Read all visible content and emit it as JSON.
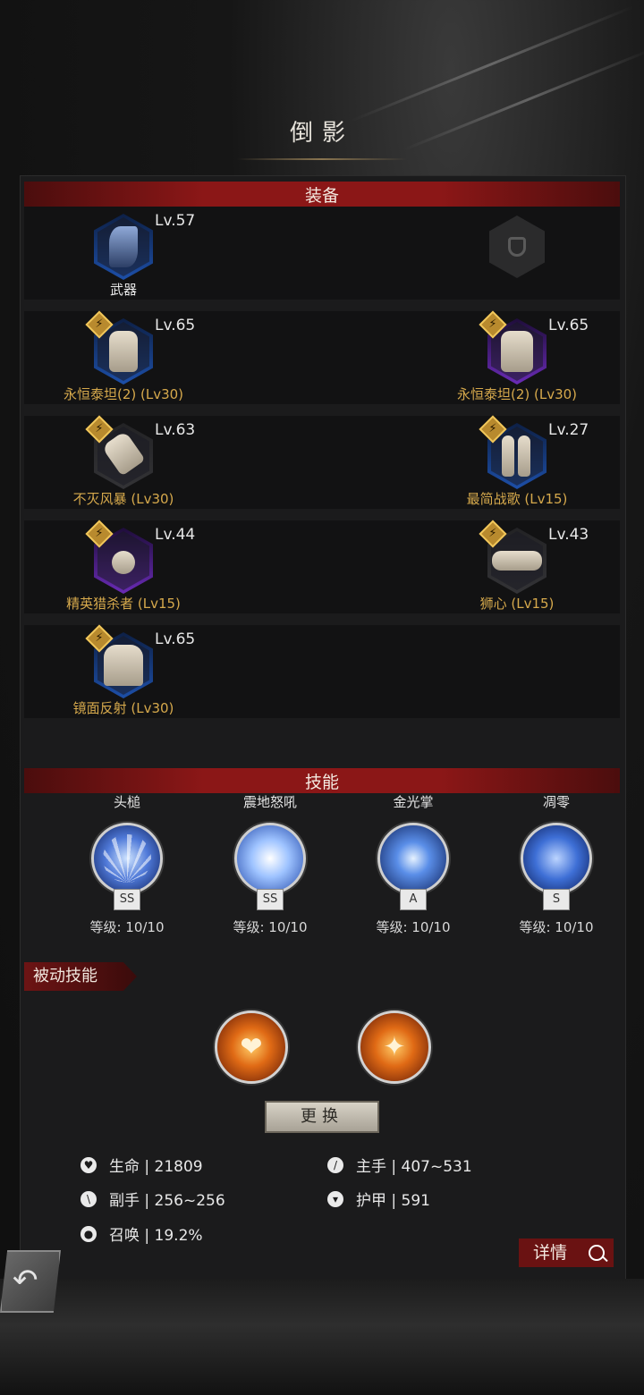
{
  "title": "倒影",
  "equipment": {
    "header": "装备",
    "rows": [
      {
        "left": {
          "level": "Lv.57",
          "name": "武器",
          "tier": "blue",
          "set": false,
          "icon": "axe-icon"
        },
        "right": {
          "level": "",
          "name": "",
          "tier": "empty",
          "set": false,
          "icon": "shield-slot-icon"
        }
      },
      {
        "left": {
          "level": "Lv.65",
          "name": "永恒泰坦(2) (Lv30)",
          "tier": "blue",
          "set": true,
          "icon": "helmet-icon"
        },
        "right": {
          "level": "Lv.65",
          "name": "永恒泰坦(2) (Lv30)",
          "tier": "purple",
          "set": true,
          "icon": "chest-armor-icon"
        }
      },
      {
        "left": {
          "level": "Lv.63",
          "name": "不灭风暴 (Lv30)",
          "tier": "dark",
          "set": true,
          "icon": "gauntlet-icon"
        },
        "right": {
          "level": "Lv.27",
          "name": "最简战歌 (Lv15)",
          "tier": "blue",
          "set": true,
          "icon": "boots-icon"
        }
      },
      {
        "left": {
          "level": "Lv.44",
          "name": "精英猎杀者 (Lv15)",
          "tier": "purple",
          "set": true,
          "icon": "trinket-icon"
        },
        "right": {
          "level": "Lv.43",
          "name": "狮心 (Lv15)",
          "tier": "dark",
          "set": true,
          "icon": "belt-icon"
        }
      },
      {
        "left": {
          "level": "Lv.65",
          "name": "镜面反射 (Lv30)",
          "tier": "blue",
          "set": true,
          "icon": "cloak-icon"
        },
        "right": null
      }
    ]
  },
  "skills": {
    "header": "技能",
    "items": [
      {
        "name": "头槌",
        "grade": "SS",
        "level": "等级: 10/10",
        "icon": "claw-strike-icon"
      },
      {
        "name": "震地怒吼",
        "grade": "SS",
        "level": "等级: 10/10",
        "icon": "roar-icon"
      },
      {
        "name": "金光掌",
        "grade": "A",
        "level": "等级: 10/10",
        "icon": "lightning-palm-icon"
      },
      {
        "name": "凋零",
        "grade": "S",
        "level": "等级: 10/10",
        "icon": "rose-icon"
      }
    ]
  },
  "passive": {
    "label": "被动技能",
    "items": [
      {
        "icon": "heart-hands-icon",
        "glyph": "❤"
      },
      {
        "icon": "spider-sword-icon",
        "glyph": "✦"
      }
    ],
    "swap_label": "更换"
  },
  "stats": {
    "hp": "生命 | 21809",
    "main_hand": "主手 | 407~531",
    "off_hand": "副手 | 256~256",
    "armor": "护甲 | 591",
    "summon": "召唤 | 19.2%"
  },
  "details_label": "详情"
}
